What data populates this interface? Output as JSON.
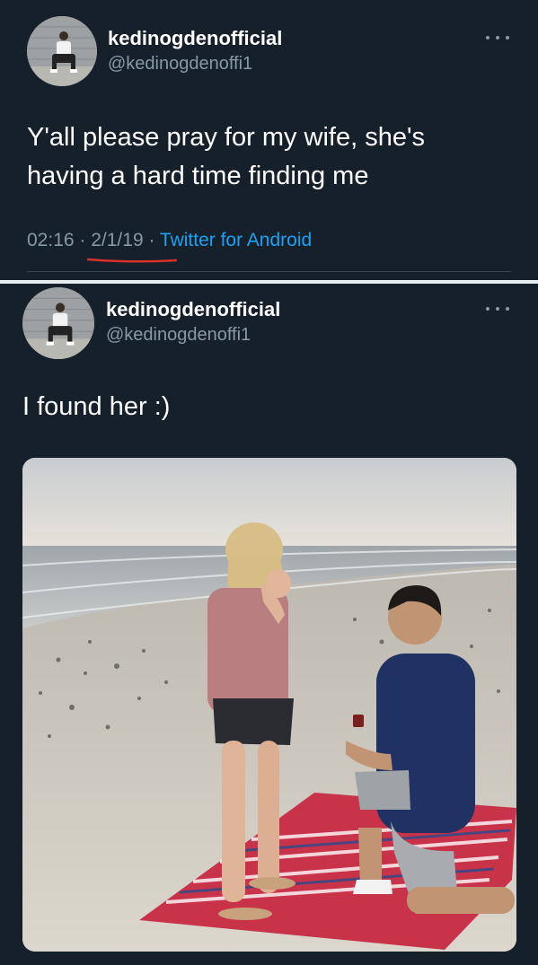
{
  "tweet1": {
    "display_name": "kedinogdenofficial",
    "handle": "@kedinogdenoffi1",
    "text_line1": "Y'all please pray for my wife, she's",
    "text_line2": "having a hard time finding me",
    "time": "02:16",
    "date": "2/1/19",
    "source": "Twitter for Android",
    "separator": " · "
  },
  "tweet2": {
    "display_name": "kedinogdenofficial",
    "handle": "@kedinogdenoffi1",
    "text": "I found her :)"
  },
  "colors": {
    "background": "#15202b",
    "primary_text": "#ffffff",
    "secondary_text": "#8899a6",
    "link": "#1da1f2",
    "annotation_underline": "#d9302b"
  },
  "icons": {
    "more": "more-options-icon"
  }
}
